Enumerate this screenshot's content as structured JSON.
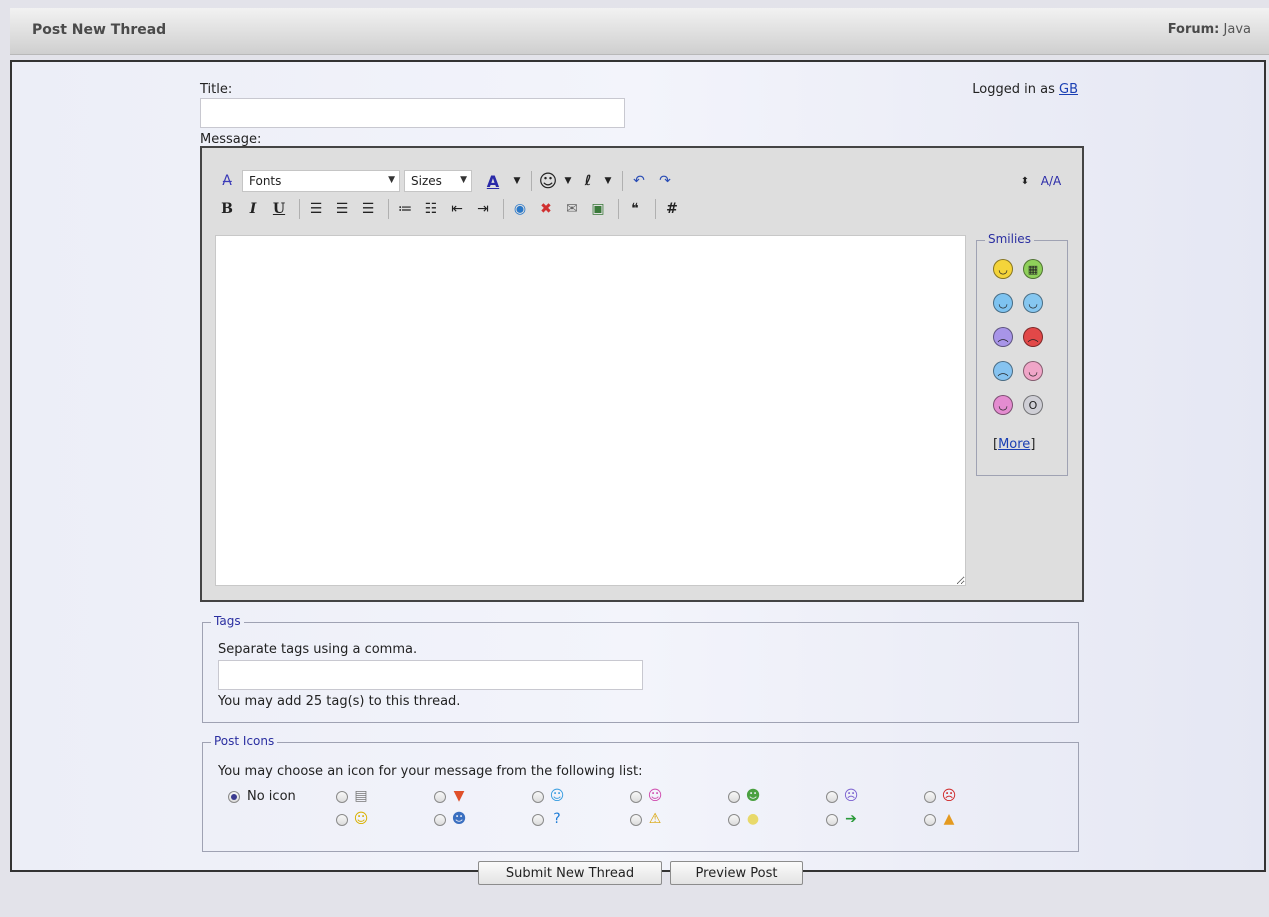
{
  "header": {
    "title": "Post New Thread",
    "forum_label": "Forum:",
    "forum_value": "Java"
  },
  "form": {
    "title_label": "Title:",
    "title_value": "",
    "message_label": "Message:",
    "login_text": "Logged in as",
    "login_user": "GB"
  },
  "editor": {
    "font_select": "Fonts",
    "size_select": "Sizes",
    "font_color": "#000000"
  },
  "smilies": {
    "legend": "Smilies",
    "more": "More",
    "faces": [
      {
        "color": "#f4d43a",
        "glyph": "◡"
      },
      {
        "color": "#8fd05a",
        "glyph": "▦"
      },
      {
        "color": "#7ec3f0",
        "glyph": "◡"
      },
      {
        "color": "#86c7f0",
        "glyph": "◡"
      },
      {
        "color": "#a895e8",
        "glyph": "︵"
      },
      {
        "color": "#e24848",
        "glyph": "︵"
      },
      {
        "color": "#86c3f0",
        "glyph": "︵"
      },
      {
        "color": "#f0a6c8",
        "glyph": "◡"
      },
      {
        "color": "#e48cd0",
        "glyph": "◡"
      },
      {
        "color": "#cfcfd6",
        "glyph": "O"
      }
    ]
  },
  "tags": {
    "legend": "Tags",
    "help": "Separate tags using a comma.",
    "value": "",
    "note": "You may add 25 tag(s) to this thread."
  },
  "post_icons": {
    "legend": "Post Icons",
    "intro": "You may choose an icon for your message from the following list:",
    "no_icon": "No icon",
    "row1": [
      {
        "name": "page-icon",
        "glyph": "▤",
        "color": "#777"
      },
      {
        "name": "thumbs-down-icon",
        "glyph": "▼",
        "color": "#e0502a"
      },
      {
        "name": "smile-blue-icon",
        "glyph": "☺",
        "color": "#3a9ee0"
      },
      {
        "name": "smile-pink-icon",
        "glyph": "☺",
        "color": "#d04fb0"
      },
      {
        "name": "grin-green-icon",
        "glyph": "☻",
        "color": "#4aa040"
      },
      {
        "name": "sad-purple-icon",
        "glyph": "☹",
        "color": "#7d64d0"
      },
      {
        "name": "angry-red-icon",
        "glyph": "☹",
        "color": "#d02a2a"
      }
    ],
    "row2": [
      {
        "name": "smile-yellow-icon",
        "glyph": "☺",
        "color": "#d9b000"
      },
      {
        "name": "cool-icon",
        "glyph": "☻",
        "color": "#3a6fc0"
      },
      {
        "name": "question-icon",
        "glyph": "?",
        "color": "#1e7cd6"
      },
      {
        "name": "warning-icon",
        "glyph": "⚠",
        "color": "#d9a300"
      },
      {
        "name": "lightbulb-icon",
        "glyph": "●",
        "color": "#e8d96a"
      },
      {
        "name": "arrow-right-icon",
        "glyph": "➔",
        "color": "#2a9a3a"
      },
      {
        "name": "thumbs-up-icon",
        "glyph": "▲",
        "color": "#e49a20"
      }
    ]
  },
  "buttons": {
    "submit": "Submit New Thread",
    "preview": "Preview Post"
  }
}
